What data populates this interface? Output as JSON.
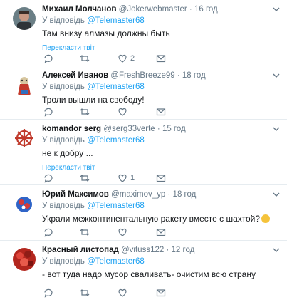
{
  "tweets": [
    {
      "name": "Михаил Молчанов",
      "handle": "@Jokerwebmaster",
      "separator": "·",
      "time": "16 год",
      "reply_prefix": "У відповідь",
      "reply_to": "@Telemaster68",
      "text": "Там внизу алмазы должны быть",
      "translate": "",
      "reply_count": "",
      "retweet_count": "",
      "like_count": "2"
    },
    {
      "name": "Алексей Иванов",
      "handle": "@FreshBreeze99",
      "separator": "·",
      "time": "18 год",
      "reply_prefix": "У відповідь",
      "reply_to": "@Telemaster68",
      "text": "Троли вышли на свободу!",
      "translate": "",
      "reply_count": "",
      "retweet_count": "",
      "like_count": ""
    },
    {
      "name": "komandor serg",
      "handle": "@serg33verte",
      "separator": "·",
      "time": "15 год",
      "reply_prefix": "У відповідь",
      "reply_to": "@Telemaster68",
      "text": "не к добру ...",
      "translate": "Перекласти твіт",
      "reply_count": "",
      "retweet_count": "",
      "like_count": "1"
    },
    {
      "name": "Юрий Максимов",
      "handle": "@maximov_yp",
      "separator": "·",
      "time": "18 год",
      "reply_prefix": "У відповідь",
      "reply_to": "@Telemaster68",
      "text": "Украли межконтинентальную ракету вместе с шахтой?",
      "translate": "",
      "reply_count": "",
      "retweet_count": "",
      "like_count": ""
    },
    {
      "name": "Красный листопад",
      "handle": "@vituss122",
      "separator": "·",
      "time": "12 год",
      "reply_prefix": "У відповідь",
      "reply_to": "@Telemaster68",
      "text": "- вот туда надо мусор сваливать- очистим всю страну",
      "translate": "",
      "reply_count": "",
      "retweet_count": "",
      "like_count": ""
    }
  ],
  "first_translate": "Перекласти твіт",
  "icons": {
    "reply": "reply-icon",
    "retweet": "retweet-icon",
    "like": "heart-icon",
    "dm": "envelope-icon",
    "menu": "chevron-down-icon"
  },
  "colors": {
    "link": "#1da1f2",
    "muted": "#657786",
    "divider": "#e6ecf0"
  }
}
